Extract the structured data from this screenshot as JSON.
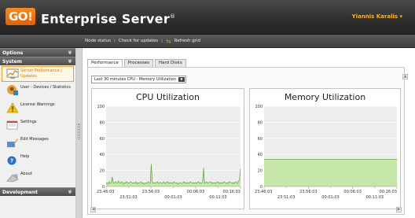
{
  "header": {
    "logo": "GO!",
    "title": "Enterprise Server",
    "title_mark": "®",
    "user": "Yiannis Karalis ▾"
  },
  "toolbar": {
    "node_status": "Node status",
    "check_updates": "Check for updates",
    "refresh": "Refresh grid",
    "sep": "|"
  },
  "sidebar": {
    "options_label": "Options",
    "system_label": "System",
    "development_label": "Development",
    "items": [
      {
        "label": "Server Performance / Updates",
        "icon": "server-performance-icon"
      },
      {
        "label": "User - Devices / Statistics",
        "icon": "user-devices-icon"
      },
      {
        "label": "License Warnings",
        "icon": "warning-icon"
      },
      {
        "label": "Settings",
        "icon": "settings-icon"
      },
      {
        "label": "Edit Messages",
        "icon": "edit-messages-icon"
      },
      {
        "label": "Help",
        "icon": "help-icon"
      },
      {
        "label": "About",
        "icon": "about-icon"
      }
    ]
  },
  "tabs": [
    "Performance",
    "Processes",
    "Hard Disks"
  ],
  "range_select": {
    "value": "Last 30 minutes CPU - Memory Utilization"
  },
  "colors": {
    "accent": "#f07800",
    "series_line": "#5aa832",
    "series_fill": "#c5e6a8"
  },
  "chart_data": [
    {
      "type": "area",
      "title": "CPU Utilization",
      "ylim": [
        0,
        100
      ],
      "yticks": [
        "0",
        "20",
        "40",
        "60",
        "80",
        "100"
      ],
      "xticks_top": [
        "23:46:03",
        "23:56:03",
        "00:06:03",
        "00:16:03"
      ],
      "xticks_bottom": [
        "23:51:03",
        "00:01:03",
        "00:11:03"
      ],
      "grid": true,
      "values": [
        4,
        5,
        3,
        6,
        4,
        5,
        12,
        5,
        4,
        6,
        5,
        4,
        7,
        5,
        4,
        6,
        5,
        3,
        5,
        4,
        6,
        5,
        4,
        5,
        6,
        5,
        4,
        5,
        4,
        6,
        3,
        5,
        4,
        5,
        6,
        4,
        5,
        3,
        4,
        5,
        4,
        6,
        5,
        4,
        28,
        6,
        4,
        5,
        4,
        5,
        6,
        4,
        5,
        5,
        4,
        4,
        6,
        4,
        5,
        5,
        6,
        4,
        5,
        4,
        5,
        4,
        6,
        5,
        4,
        5,
        3,
        4,
        5,
        4,
        4,
        5,
        6,
        4,
        5,
        4,
        5,
        4,
        6,
        5,
        4,
        5,
        4,
        5,
        4,
        5,
        6,
        4,
        5,
        4,
        5,
        23,
        4,
        5,
        6,
        4,
        5,
        5,
        6,
        4,
        5,
        4,
        5,
        4,
        5,
        6,
        4,
        5,
        4,
        5,
        4,
        6,
        5,
        4,
        5,
        4,
        6,
        5,
        5,
        4,
        5,
        4,
        6,
        5,
        4,
        7,
        8,
        22
      ]
    },
    {
      "type": "area",
      "title": "Memory Utilization",
      "ylim": [
        0,
        100
      ],
      "yticks": [
        "0",
        "20",
        "40",
        "60",
        "80",
        "100"
      ],
      "xticks_top": [
        "23:46:03",
        "23:56:03",
        "00:06:03",
        "00:16:03"
      ],
      "xticks_bottom": [
        "23:51:03",
        "00:01:03",
        "00:11:03"
      ],
      "grid": true,
      "values": [
        34,
        34,
        34,
        34,
        34,
        34,
        34,
        34,
        34,
        34,
        34,
        34,
        34,
        34,
        34,
        34,
        34,
        34,
        34,
        34,
        34,
        34,
        34,
        34,
        34,
        34,
        34,
        34,
        34,
        34
      ]
    }
  ]
}
